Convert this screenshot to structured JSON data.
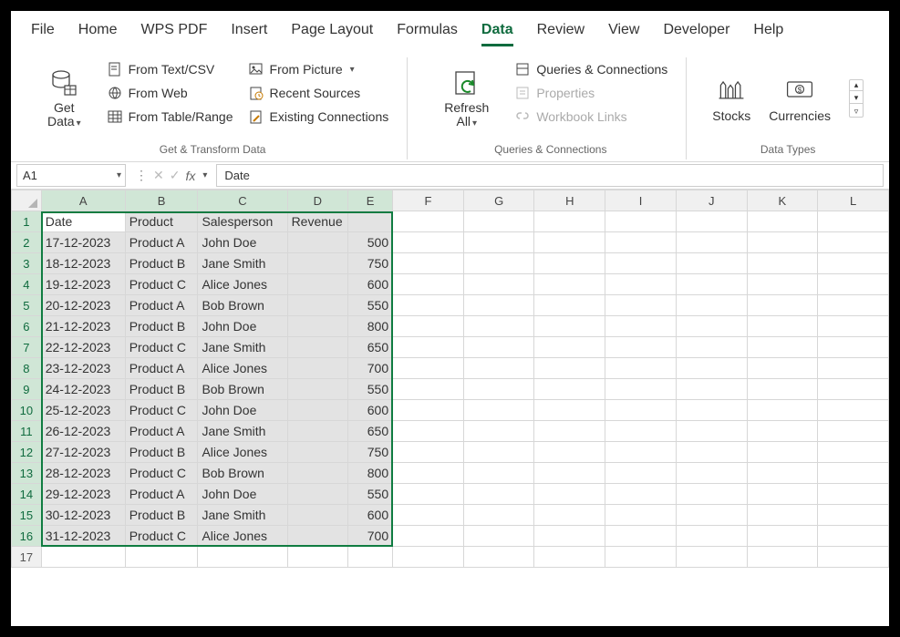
{
  "tabs": {
    "items": [
      "File",
      "Home",
      "WPS PDF",
      "Insert",
      "Page Layout",
      "Formulas",
      "Data",
      "Review",
      "View",
      "Developer",
      "Help"
    ],
    "active": "Data"
  },
  "ribbon": {
    "getdata": {
      "caption": "Get\nData"
    },
    "from_text": "From Text/CSV",
    "from_web": "From Web",
    "from_table": "From Table/Range",
    "from_picture": "From Picture",
    "recent_sources": "Recent Sources",
    "existing_conn": "Existing Connections",
    "group1_label": "Get & Transform Data",
    "refresh_all": {
      "caption": "Refresh\nAll"
    },
    "queries_conn": "Queries & Connections",
    "properties": "Properties",
    "workbook_links": "Workbook Links",
    "group2_label": "Queries & Connections",
    "stocks": "Stocks",
    "currencies": "Currencies",
    "group3_label": "Data Types"
  },
  "formula_bar": {
    "namebox": "A1",
    "content": "Date"
  },
  "sheet": {
    "columns": [
      "A",
      "B",
      "C",
      "D",
      "E",
      "F",
      "G",
      "H",
      "I",
      "J",
      "K",
      "L"
    ],
    "selected_cols": 5,
    "selected_rows": 16,
    "headers": [
      "Date",
      "Product",
      "Salesperson",
      "Revenue",
      ""
    ],
    "rows": [
      [
        "17-12-2023",
        "Product A",
        "John Doe",
        "",
        "500"
      ],
      [
        "18-12-2023",
        "Product B",
        "Jane Smith",
        "",
        "750"
      ],
      [
        "19-12-2023",
        "Product C",
        "Alice Jones",
        "",
        "600"
      ],
      [
        "20-12-2023",
        "Product A",
        "Bob Brown",
        "",
        "550"
      ],
      [
        "21-12-2023",
        "Product B",
        "John Doe",
        "",
        "800"
      ],
      [
        "22-12-2023",
        "Product C",
        "Jane Smith",
        "",
        "650"
      ],
      [
        "23-12-2023",
        "Product A",
        "Alice Jones",
        "",
        "700"
      ],
      [
        "24-12-2023",
        "Product B",
        "Bob Brown",
        "",
        "550"
      ],
      [
        "25-12-2023",
        "Product C",
        "John Doe",
        "",
        "600"
      ],
      [
        "26-12-2023",
        "Product A",
        "Jane Smith",
        "",
        "650"
      ],
      [
        "27-12-2023",
        "Product B",
        "Alice Jones",
        "",
        "750"
      ],
      [
        "28-12-2023",
        "Product C",
        "Bob Brown",
        "",
        "800"
      ],
      [
        "29-12-2023",
        "Product A",
        "John Doe",
        "",
        "550"
      ],
      [
        "30-12-2023",
        "Product B",
        "Jane Smith",
        "",
        "600"
      ],
      [
        "31-12-2023",
        "Product C",
        "Alice Jones",
        "",
        "700"
      ]
    ]
  }
}
